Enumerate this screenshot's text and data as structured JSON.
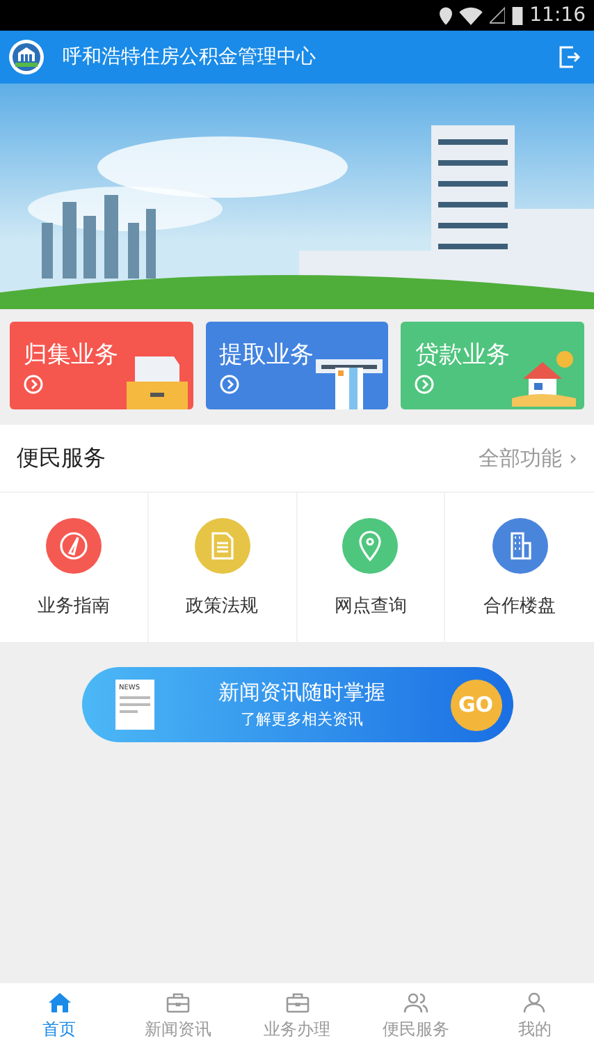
{
  "status_bar": {
    "time": "11:16"
  },
  "header": {
    "title": "呼和浩特住房公积金管理中心"
  },
  "cards": [
    {
      "label": "归集业务",
      "color": "#f5564e",
      "kind": "drawer"
    },
    {
      "label": "提取业务",
      "color": "#4283e0",
      "kind": "atm"
    },
    {
      "label": "贷款业务",
      "color": "#4fc47e",
      "kind": "house"
    }
  ],
  "services": {
    "title": "便民服务",
    "more": "全部功能",
    "more_arrow": "›",
    "items": [
      {
        "label": "业务指南",
        "color": "#f45a52",
        "kind": "compass"
      },
      {
        "label": "政策法规",
        "color": "#e6c445",
        "kind": "document"
      },
      {
        "label": "网点查询",
        "color": "#4fc67e",
        "kind": "pin"
      },
      {
        "label": "合作楼盘",
        "color": "#4a85dc",
        "kind": "building"
      }
    ]
  },
  "news_banner": {
    "badge": "NEWS",
    "title": "新闻资讯随时掌握",
    "subtitle": "了解更多相关资讯",
    "button": "GO"
  },
  "tabs": [
    {
      "label": "首页",
      "kind": "home",
      "selected": true
    },
    {
      "label": "新闻资讯",
      "kind": "briefcase",
      "selected": false
    },
    {
      "label": "业务办理",
      "kind": "briefcase",
      "selected": false
    },
    {
      "label": "便民服务",
      "kind": "people",
      "selected": false
    },
    {
      "label": "我的",
      "kind": "person",
      "selected": false
    }
  ]
}
